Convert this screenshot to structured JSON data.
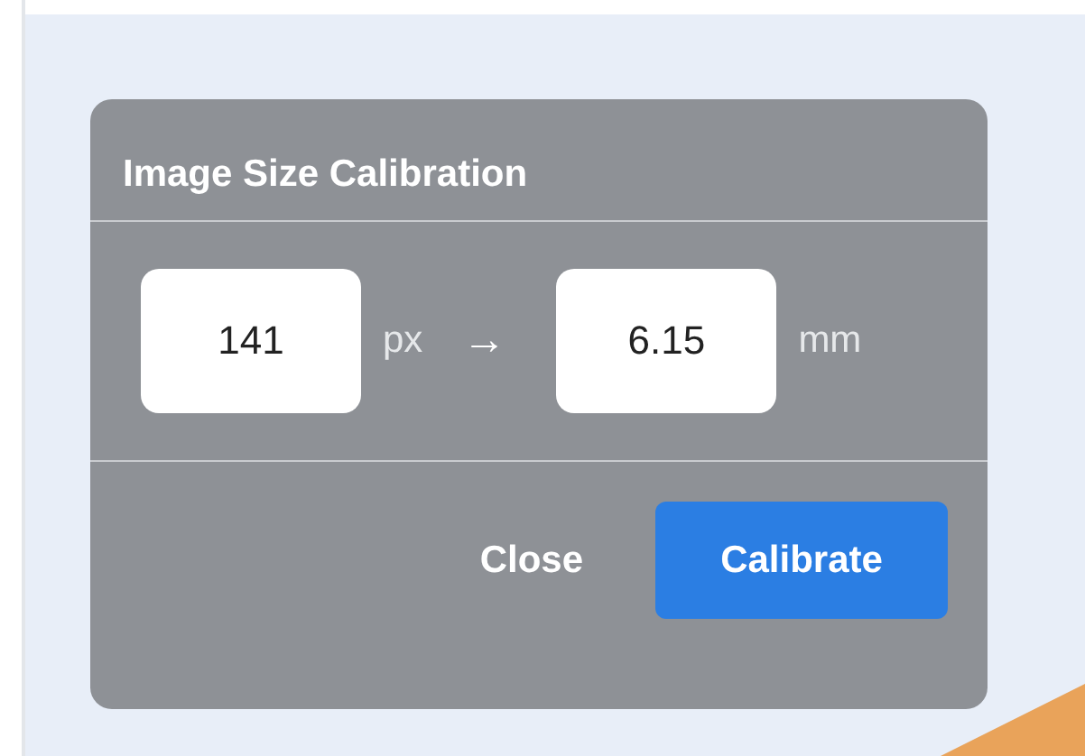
{
  "dialog": {
    "title": "Image Size Calibration",
    "fields": [
      {
        "value": "141",
        "unit": "px"
      },
      {
        "value": "6.15",
        "unit": "mm"
      }
    ],
    "arrow": "→",
    "buttons": [
      {
        "label": "Close",
        "kind": "text"
      },
      {
        "label": "Calibrate",
        "kind": "primary"
      }
    ]
  }
}
